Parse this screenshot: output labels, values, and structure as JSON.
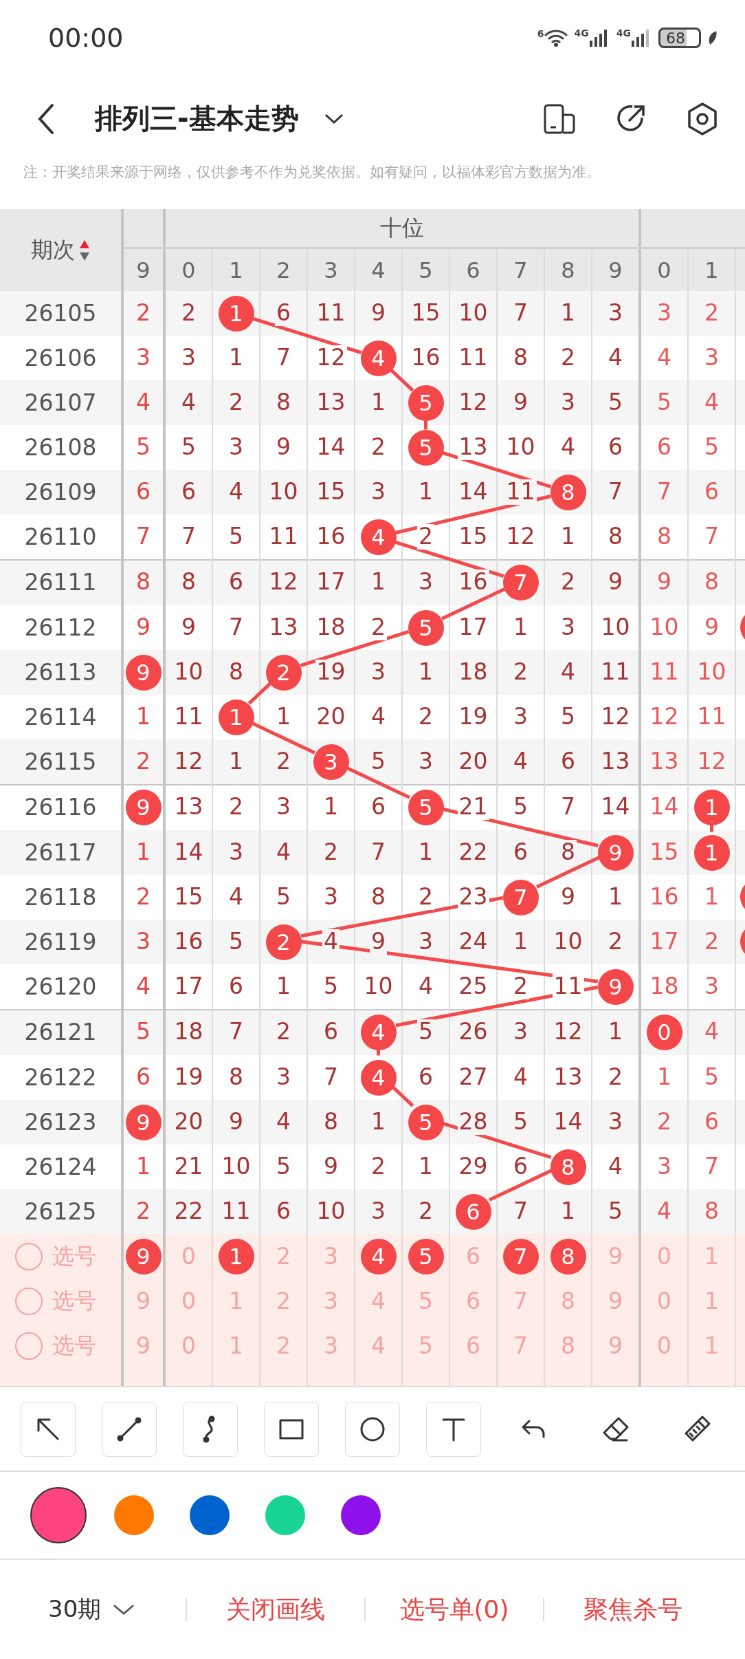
{
  "status_bar": {
    "time": "00:00",
    "wifi_label": "6",
    "signals": [
      "4G",
      "4G"
    ],
    "battery": "68"
  },
  "title_bar": {
    "title": "排列三-基本走势"
  },
  "notice": "注：开奖结果来源于网络，仅供参考不作为兑奖依据。如有疑问，以福体彩官方数据为准。",
  "table": {
    "period_label": "期次",
    "sort_up_active": true,
    "group_label": "十位",
    "prev_digits": [
      "9"
    ],
    "tens_digits": [
      "0",
      "1",
      "2",
      "3",
      "4",
      "5",
      "6",
      "7",
      "8",
      "9"
    ],
    "ones_digits": [
      "0",
      "1"
    ],
    "rows": [
      {
        "period": "26105",
        "prev": {
          "text": "2",
          "hit": false
        },
        "tens": [
          {
            "text": "2",
            "hit": false
          },
          {
            "text": "1",
            "hit": true
          },
          {
            "text": "6",
            "hit": false
          },
          {
            "text": "11",
            "hit": false
          },
          {
            "text": "9",
            "hit": false
          },
          {
            "text": "15",
            "hit": false
          },
          {
            "text": "10",
            "hit": false
          },
          {
            "text": "7",
            "hit": false
          },
          {
            "text": "1",
            "hit": false
          },
          {
            "text": "3",
            "hit": false
          }
        ],
        "ones": [
          {
            "text": "3",
            "hit": false
          },
          {
            "text": "2",
            "hit": false
          }
        ],
        "edge_hit": false
      },
      {
        "period": "26106",
        "prev": {
          "text": "3",
          "hit": false
        },
        "tens": [
          {
            "text": "3",
            "hit": false
          },
          {
            "text": "1",
            "hit": false
          },
          {
            "text": "7",
            "hit": false
          },
          {
            "text": "12",
            "hit": false
          },
          {
            "text": "4",
            "hit": true
          },
          {
            "text": "16",
            "hit": false
          },
          {
            "text": "11",
            "hit": false
          },
          {
            "text": "8",
            "hit": false
          },
          {
            "text": "2",
            "hit": false
          },
          {
            "text": "4",
            "hit": false
          }
        ],
        "ones": [
          {
            "text": "4",
            "hit": false
          },
          {
            "text": "3",
            "hit": false
          }
        ],
        "edge_hit": false
      },
      {
        "period": "26107",
        "prev": {
          "text": "4",
          "hit": false
        },
        "tens": [
          {
            "text": "4",
            "hit": false
          },
          {
            "text": "2",
            "hit": false
          },
          {
            "text": "8",
            "hit": false
          },
          {
            "text": "13",
            "hit": false
          },
          {
            "text": "1",
            "hit": false
          },
          {
            "text": "5",
            "hit": true
          },
          {
            "text": "12",
            "hit": false
          },
          {
            "text": "9",
            "hit": false
          },
          {
            "text": "3",
            "hit": false
          },
          {
            "text": "5",
            "hit": false
          }
        ],
        "ones": [
          {
            "text": "5",
            "hit": false
          },
          {
            "text": "4",
            "hit": false
          }
        ],
        "edge_hit": false
      },
      {
        "period": "26108",
        "prev": {
          "text": "5",
          "hit": false
        },
        "tens": [
          {
            "text": "5",
            "hit": false
          },
          {
            "text": "3",
            "hit": false
          },
          {
            "text": "9",
            "hit": false
          },
          {
            "text": "14",
            "hit": false
          },
          {
            "text": "2",
            "hit": false
          },
          {
            "text": "5",
            "hit": true
          },
          {
            "text": "13",
            "hit": false
          },
          {
            "text": "10",
            "hit": false
          },
          {
            "text": "4",
            "hit": false
          },
          {
            "text": "6",
            "hit": false
          }
        ],
        "ones": [
          {
            "text": "6",
            "hit": false
          },
          {
            "text": "5",
            "hit": false
          }
        ],
        "edge_hit": false
      },
      {
        "period": "26109",
        "prev": {
          "text": "6",
          "hit": false
        },
        "tens": [
          {
            "text": "6",
            "hit": false
          },
          {
            "text": "4",
            "hit": false
          },
          {
            "text": "10",
            "hit": false
          },
          {
            "text": "15",
            "hit": false
          },
          {
            "text": "3",
            "hit": false
          },
          {
            "text": "1",
            "hit": false
          },
          {
            "text": "14",
            "hit": false
          },
          {
            "text": "11",
            "hit": false
          },
          {
            "text": "8",
            "hit": true
          },
          {
            "text": "7",
            "hit": false
          }
        ],
        "ones": [
          {
            "text": "7",
            "hit": false
          },
          {
            "text": "6",
            "hit": false
          }
        ],
        "edge_hit": false
      },
      {
        "period": "26110",
        "prev": {
          "text": "7",
          "hit": false
        },
        "tens": [
          {
            "text": "7",
            "hit": false
          },
          {
            "text": "5",
            "hit": false
          },
          {
            "text": "11",
            "hit": false
          },
          {
            "text": "16",
            "hit": false
          },
          {
            "text": "4",
            "hit": true
          },
          {
            "text": "2",
            "hit": false
          },
          {
            "text": "15",
            "hit": false
          },
          {
            "text": "12",
            "hit": false
          },
          {
            "text": "1",
            "hit": false
          },
          {
            "text": "8",
            "hit": false
          }
        ],
        "ones": [
          {
            "text": "8",
            "hit": false
          },
          {
            "text": "7",
            "hit": false
          }
        ],
        "edge_hit": false
      },
      {
        "period": "26111",
        "prev": {
          "text": "8",
          "hit": false
        },
        "tens": [
          {
            "text": "8",
            "hit": false
          },
          {
            "text": "6",
            "hit": false
          },
          {
            "text": "12",
            "hit": false
          },
          {
            "text": "17",
            "hit": false
          },
          {
            "text": "1",
            "hit": false
          },
          {
            "text": "3",
            "hit": false
          },
          {
            "text": "16",
            "hit": false
          },
          {
            "text": "7",
            "hit": true
          },
          {
            "text": "2",
            "hit": false
          },
          {
            "text": "9",
            "hit": false
          }
        ],
        "ones": [
          {
            "text": "9",
            "hit": false
          },
          {
            "text": "8",
            "hit": false
          }
        ],
        "edge_hit": false
      },
      {
        "period": "26112",
        "prev": {
          "text": "9",
          "hit": false
        },
        "tens": [
          {
            "text": "9",
            "hit": false
          },
          {
            "text": "7",
            "hit": false
          },
          {
            "text": "13",
            "hit": false
          },
          {
            "text": "18",
            "hit": false
          },
          {
            "text": "2",
            "hit": false
          },
          {
            "text": "5",
            "hit": true
          },
          {
            "text": "17",
            "hit": false
          },
          {
            "text": "1",
            "hit": false
          },
          {
            "text": "3",
            "hit": false
          },
          {
            "text": "10",
            "hit": false
          }
        ],
        "ones": [
          {
            "text": "10",
            "hit": false
          },
          {
            "text": "9",
            "hit": false
          }
        ],
        "edge_hit": true
      },
      {
        "period": "26113",
        "prev": {
          "text": "9",
          "hit": true
        },
        "tens": [
          {
            "text": "10",
            "hit": false
          },
          {
            "text": "8",
            "hit": false
          },
          {
            "text": "2",
            "hit": true
          },
          {
            "text": "19",
            "hit": false
          },
          {
            "text": "3",
            "hit": false
          },
          {
            "text": "1",
            "hit": false
          },
          {
            "text": "18",
            "hit": false
          },
          {
            "text": "2",
            "hit": false
          },
          {
            "text": "4",
            "hit": false
          },
          {
            "text": "11",
            "hit": false
          }
        ],
        "ones": [
          {
            "text": "11",
            "hit": false
          },
          {
            "text": "10",
            "hit": false
          }
        ],
        "edge_hit": false
      },
      {
        "period": "26114",
        "prev": {
          "text": "1",
          "hit": false
        },
        "tens": [
          {
            "text": "11",
            "hit": false
          },
          {
            "text": "1",
            "hit": true
          },
          {
            "text": "1",
            "hit": false
          },
          {
            "text": "20",
            "hit": false
          },
          {
            "text": "4",
            "hit": false
          },
          {
            "text": "2",
            "hit": false
          },
          {
            "text": "19",
            "hit": false
          },
          {
            "text": "3",
            "hit": false
          },
          {
            "text": "5",
            "hit": false
          },
          {
            "text": "12",
            "hit": false
          }
        ],
        "ones": [
          {
            "text": "12",
            "hit": false
          },
          {
            "text": "11",
            "hit": false
          }
        ],
        "edge_hit": false
      },
      {
        "period": "26115",
        "prev": {
          "text": "2",
          "hit": false
        },
        "tens": [
          {
            "text": "12",
            "hit": false
          },
          {
            "text": "1",
            "hit": false
          },
          {
            "text": "2",
            "hit": false
          },
          {
            "text": "3",
            "hit": true
          },
          {
            "text": "5",
            "hit": false
          },
          {
            "text": "3",
            "hit": false
          },
          {
            "text": "20",
            "hit": false
          },
          {
            "text": "4",
            "hit": false
          },
          {
            "text": "6",
            "hit": false
          },
          {
            "text": "13",
            "hit": false
          }
        ],
        "ones": [
          {
            "text": "13",
            "hit": false
          },
          {
            "text": "12",
            "hit": false
          }
        ],
        "edge_hit": false
      },
      {
        "period": "26116",
        "prev": {
          "text": "9",
          "hit": true
        },
        "tens": [
          {
            "text": "13",
            "hit": false
          },
          {
            "text": "2",
            "hit": false
          },
          {
            "text": "3",
            "hit": false
          },
          {
            "text": "1",
            "hit": false
          },
          {
            "text": "6",
            "hit": false
          },
          {
            "text": "5",
            "hit": true
          },
          {
            "text": "21",
            "hit": false
          },
          {
            "text": "5",
            "hit": false
          },
          {
            "text": "7",
            "hit": false
          },
          {
            "text": "14",
            "hit": false
          }
        ],
        "ones": [
          {
            "text": "14",
            "hit": false
          },
          {
            "text": "1",
            "hit": true
          }
        ],
        "edge_hit": false
      },
      {
        "period": "26117",
        "prev": {
          "text": "1",
          "hit": false
        },
        "tens": [
          {
            "text": "14",
            "hit": false
          },
          {
            "text": "3",
            "hit": false
          },
          {
            "text": "4",
            "hit": false
          },
          {
            "text": "2",
            "hit": false
          },
          {
            "text": "7",
            "hit": false
          },
          {
            "text": "1",
            "hit": false
          },
          {
            "text": "22",
            "hit": false
          },
          {
            "text": "6",
            "hit": false
          },
          {
            "text": "8",
            "hit": false
          },
          {
            "text": "9",
            "hit": true
          }
        ],
        "ones": [
          {
            "text": "15",
            "hit": false
          },
          {
            "text": "1",
            "hit": true
          }
        ],
        "edge_hit": false
      },
      {
        "period": "26118",
        "prev": {
          "text": "2",
          "hit": false
        },
        "tens": [
          {
            "text": "15",
            "hit": false
          },
          {
            "text": "4",
            "hit": false
          },
          {
            "text": "5",
            "hit": false
          },
          {
            "text": "3",
            "hit": false
          },
          {
            "text": "8",
            "hit": false
          },
          {
            "text": "2",
            "hit": false
          },
          {
            "text": "23",
            "hit": false
          },
          {
            "text": "7",
            "hit": true
          },
          {
            "text": "9",
            "hit": false
          },
          {
            "text": "1",
            "hit": false
          }
        ],
        "ones": [
          {
            "text": "16",
            "hit": false
          },
          {
            "text": "1",
            "hit": false
          }
        ],
        "edge_hit": true
      },
      {
        "period": "26119",
        "prev": {
          "text": "3",
          "hit": false
        },
        "tens": [
          {
            "text": "16",
            "hit": false
          },
          {
            "text": "5",
            "hit": false
          },
          {
            "text": "2",
            "hit": true
          },
          {
            "text": "4",
            "hit": false
          },
          {
            "text": "9",
            "hit": false
          },
          {
            "text": "3",
            "hit": false
          },
          {
            "text": "24",
            "hit": false
          },
          {
            "text": "1",
            "hit": false
          },
          {
            "text": "10",
            "hit": false
          },
          {
            "text": "2",
            "hit": false
          }
        ],
        "ones": [
          {
            "text": "17",
            "hit": false
          },
          {
            "text": "2",
            "hit": false
          }
        ],
        "edge_hit": true
      },
      {
        "period": "26120",
        "prev": {
          "text": "4",
          "hit": false
        },
        "tens": [
          {
            "text": "17",
            "hit": false
          },
          {
            "text": "6",
            "hit": false
          },
          {
            "text": "1",
            "hit": false
          },
          {
            "text": "5",
            "hit": false
          },
          {
            "text": "10",
            "hit": false
          },
          {
            "text": "4",
            "hit": false
          },
          {
            "text": "25",
            "hit": false
          },
          {
            "text": "2",
            "hit": false
          },
          {
            "text": "11",
            "hit": false
          },
          {
            "text": "9",
            "hit": true
          }
        ],
        "ones": [
          {
            "text": "18",
            "hit": false
          },
          {
            "text": "3",
            "hit": false
          }
        ],
        "edge_hit": false
      },
      {
        "period": "26121",
        "prev": {
          "text": "5",
          "hit": false
        },
        "tens": [
          {
            "text": "18",
            "hit": false
          },
          {
            "text": "7",
            "hit": false
          },
          {
            "text": "2",
            "hit": false
          },
          {
            "text": "6",
            "hit": false
          },
          {
            "text": "4",
            "hit": true
          },
          {
            "text": "5",
            "hit": false
          },
          {
            "text": "26",
            "hit": false
          },
          {
            "text": "3",
            "hit": false
          },
          {
            "text": "12",
            "hit": false
          },
          {
            "text": "1",
            "hit": false
          }
        ],
        "ones": [
          {
            "text": "0",
            "hit": true
          },
          {
            "text": "4",
            "hit": false
          }
        ],
        "edge_hit": false
      },
      {
        "period": "26122",
        "prev": {
          "text": "6",
          "hit": false
        },
        "tens": [
          {
            "text": "19",
            "hit": false
          },
          {
            "text": "8",
            "hit": false
          },
          {
            "text": "3",
            "hit": false
          },
          {
            "text": "7",
            "hit": false
          },
          {
            "text": "4",
            "hit": true
          },
          {
            "text": "6",
            "hit": false
          },
          {
            "text": "27",
            "hit": false
          },
          {
            "text": "4",
            "hit": false
          },
          {
            "text": "13",
            "hit": false
          },
          {
            "text": "2",
            "hit": false
          }
        ],
        "ones": [
          {
            "text": "1",
            "hit": false
          },
          {
            "text": "5",
            "hit": false
          }
        ],
        "edge_hit": false
      },
      {
        "period": "26123",
        "prev": {
          "text": "9",
          "hit": true
        },
        "tens": [
          {
            "text": "20",
            "hit": false
          },
          {
            "text": "9",
            "hit": false
          },
          {
            "text": "4",
            "hit": false
          },
          {
            "text": "8",
            "hit": false
          },
          {
            "text": "1",
            "hit": false
          },
          {
            "text": "5",
            "hit": true
          },
          {
            "text": "28",
            "hit": false
          },
          {
            "text": "5",
            "hit": false
          },
          {
            "text": "14",
            "hit": false
          },
          {
            "text": "3",
            "hit": false
          }
        ],
        "ones": [
          {
            "text": "2",
            "hit": false
          },
          {
            "text": "6",
            "hit": false
          }
        ],
        "edge_hit": false
      },
      {
        "period": "26124",
        "prev": {
          "text": "1",
          "hit": false
        },
        "tens": [
          {
            "text": "21",
            "hit": false
          },
          {
            "text": "10",
            "hit": false
          },
          {
            "text": "5",
            "hit": false
          },
          {
            "text": "9",
            "hit": false
          },
          {
            "text": "2",
            "hit": false
          },
          {
            "text": "1",
            "hit": false
          },
          {
            "text": "29",
            "hit": false
          },
          {
            "text": "6",
            "hit": false
          },
          {
            "text": "8",
            "hit": true
          },
          {
            "text": "4",
            "hit": false
          }
        ],
        "ones": [
          {
            "text": "3",
            "hit": false
          },
          {
            "text": "7",
            "hit": false
          }
        ],
        "edge_hit": false
      },
      {
        "period": "26125",
        "prev": {
          "text": "2",
          "hit": false
        },
        "tens": [
          {
            "text": "22",
            "hit": false
          },
          {
            "text": "11",
            "hit": false
          },
          {
            "text": "6",
            "hit": false
          },
          {
            "text": "10",
            "hit": false
          },
          {
            "text": "3",
            "hit": false
          },
          {
            "text": "2",
            "hit": false
          },
          {
            "text": "6",
            "hit": true
          },
          {
            "text": "7",
            "hit": false
          },
          {
            "text": "1",
            "hit": false
          },
          {
            "text": "5",
            "hit": false
          }
        ],
        "ones": [
          {
            "text": "4",
            "hit": false
          },
          {
            "text": "8",
            "hit": false
          }
        ],
        "edge_hit": false
      }
    ],
    "picks": [
      {
        "checked": false,
        "label": "选号",
        "prev": {
          "text": "9",
          "picked": true
        },
        "tens": [
          {
            "text": "0",
            "picked": false
          },
          {
            "text": "1",
            "picked": true
          },
          {
            "text": "2",
            "picked": false
          },
          {
            "text": "3",
            "picked": false
          },
          {
            "text": "4",
            "picked": true
          },
          {
            "text": "5",
            "picked": true
          },
          {
            "text": "6",
            "picked": false
          },
          {
            "text": "7",
            "picked": true
          },
          {
            "text": "8",
            "picked": true
          },
          {
            "text": "9",
            "picked": false
          }
        ],
        "ones": [
          {
            "text": "0",
            "picked": false
          },
          {
            "text": "1",
            "picked": false
          }
        ]
      },
      {
        "checked": false,
        "label": "选号",
        "prev": {
          "text": "9",
          "picked": false
        },
        "tens": [
          {
            "text": "0",
            "picked": false
          },
          {
            "text": "1",
            "picked": false
          },
          {
            "text": "2",
            "picked": false
          },
          {
            "text": "3",
            "picked": false
          },
          {
            "text": "4",
            "picked": false
          },
          {
            "text": "5",
            "picked": false
          },
          {
            "text": "6",
            "picked": false
          },
          {
            "text": "7",
            "picked": false
          },
          {
            "text": "8",
            "picked": false
          },
          {
            "text": "9",
            "picked": false
          }
        ],
        "ones": [
          {
            "text": "0",
            "picked": false
          },
          {
            "text": "1",
            "picked": false
          }
        ]
      },
      {
        "checked": false,
        "label": "选号",
        "prev": {
          "text": "9",
          "picked": false
        },
        "tens": [
          {
            "text": "0",
            "picked": false
          },
          {
            "text": "1",
            "picked": false
          },
          {
            "text": "2",
            "picked": false
          },
          {
            "text": "3",
            "picked": false
          },
          {
            "text": "4",
            "picked": false
          },
          {
            "text": "5",
            "picked": false
          },
          {
            "text": "6",
            "picked": false
          },
          {
            "text": "7",
            "picked": false
          },
          {
            "text": "8",
            "picked": false
          },
          {
            "text": "9",
            "picked": false
          }
        ],
        "ones": [
          {
            "text": "0",
            "picked": false
          },
          {
            "text": "1",
            "picked": false
          }
        ]
      }
    ]
  },
  "tools": [
    {
      "kind": "arrow",
      "boxed": true
    },
    {
      "kind": "line",
      "boxed": true
    },
    {
      "kind": "curve",
      "boxed": true
    },
    {
      "kind": "rect",
      "boxed": true
    },
    {
      "kind": "circle",
      "boxed": true
    },
    {
      "kind": "text",
      "boxed": true
    },
    {
      "kind": "undo",
      "boxed": false
    },
    {
      "kind": "eraser",
      "boxed": false
    },
    {
      "kind": "brush",
      "boxed": false
    }
  ],
  "colors": [
    {
      "color": "#ff4580",
      "selected": true
    },
    {
      "color": "#ff7800",
      "selected": false
    },
    {
      "color": "#0062cc",
      "selected": false
    },
    {
      "color": "#17d495",
      "selected": false
    },
    {
      "color": "#9012ea",
      "selected": false
    }
  ],
  "bottom_bar": {
    "period": "30期",
    "actions": [
      "关闭画线",
      "选号单(0)",
      "聚焦杀号"
    ]
  }
}
